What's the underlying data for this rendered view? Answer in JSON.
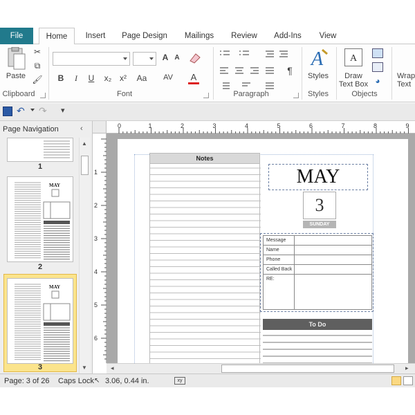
{
  "tabs": [
    "File",
    "Home",
    "Insert",
    "Page Design",
    "Mailings",
    "Review",
    "Add-Ins",
    "View"
  ],
  "ribbon": {
    "clipboard": {
      "label": "Clipboard",
      "paste": "Paste"
    },
    "font": {
      "label": "Font",
      "bold": "B",
      "italic": "I",
      "underline": "U",
      "subscript": "x₂",
      "superscript": "x²",
      "case": "Aa",
      "grow": "A",
      "shrink": "A",
      "spacing": "AV",
      "color": "A"
    },
    "paragraph": {
      "label": "Paragraph",
      "pilcrow": "¶"
    },
    "styles": {
      "label": "Styles",
      "button": "Styles"
    },
    "objects": {
      "label": "Objects",
      "draw_text_box": "Draw Text Box",
      "wrap_text": "Wrap Text"
    }
  },
  "nav": {
    "title": "Page Navigation",
    "pages": [
      "1",
      "2",
      "3"
    ]
  },
  "document": {
    "notes_header": "Notes",
    "month": "MAY",
    "day_number": "3",
    "day_name": "SUNDAY",
    "message_labels": [
      "Message",
      "Name",
      "Phone",
      "Called Back",
      "RE:"
    ],
    "todo_header": "To Do"
  },
  "ruler_numbers": [
    "1",
    "2",
    "3",
    "4",
    "5",
    "6",
    "7",
    "8",
    "9"
  ],
  "vruler_numbers": [
    "1",
    "2",
    "3",
    "4",
    "5",
    "6"
  ],
  "status": {
    "page": "Page: 3 of 26",
    "caps": "Caps Lock",
    "position": "3.06, 0.44 in."
  }
}
